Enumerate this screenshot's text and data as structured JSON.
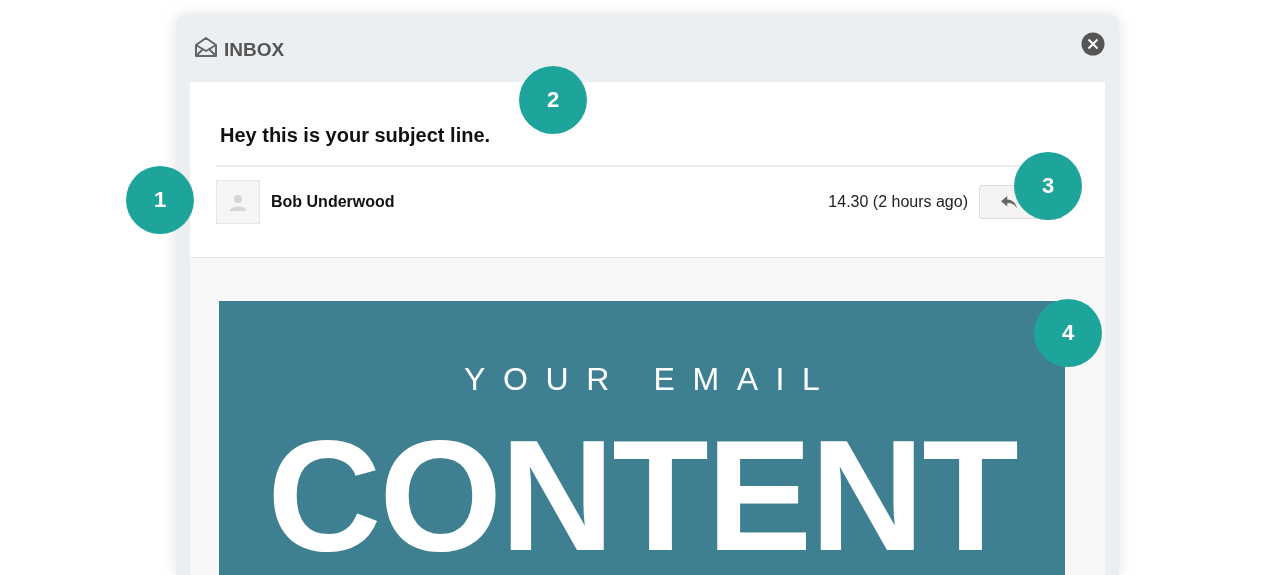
{
  "window": {
    "title": "INBOX"
  },
  "message": {
    "subject": "Hey this is your subject line.",
    "sender": "Bob Underwood",
    "time": "14.30 (2 hours ago)"
  },
  "banner": {
    "kicker": "YOUR EMAIL",
    "headline": "CONTENT"
  },
  "markers": [
    {
      "label": "1"
    },
    {
      "label": "2"
    },
    {
      "label": "3"
    },
    {
      "label": "4"
    }
  ]
}
